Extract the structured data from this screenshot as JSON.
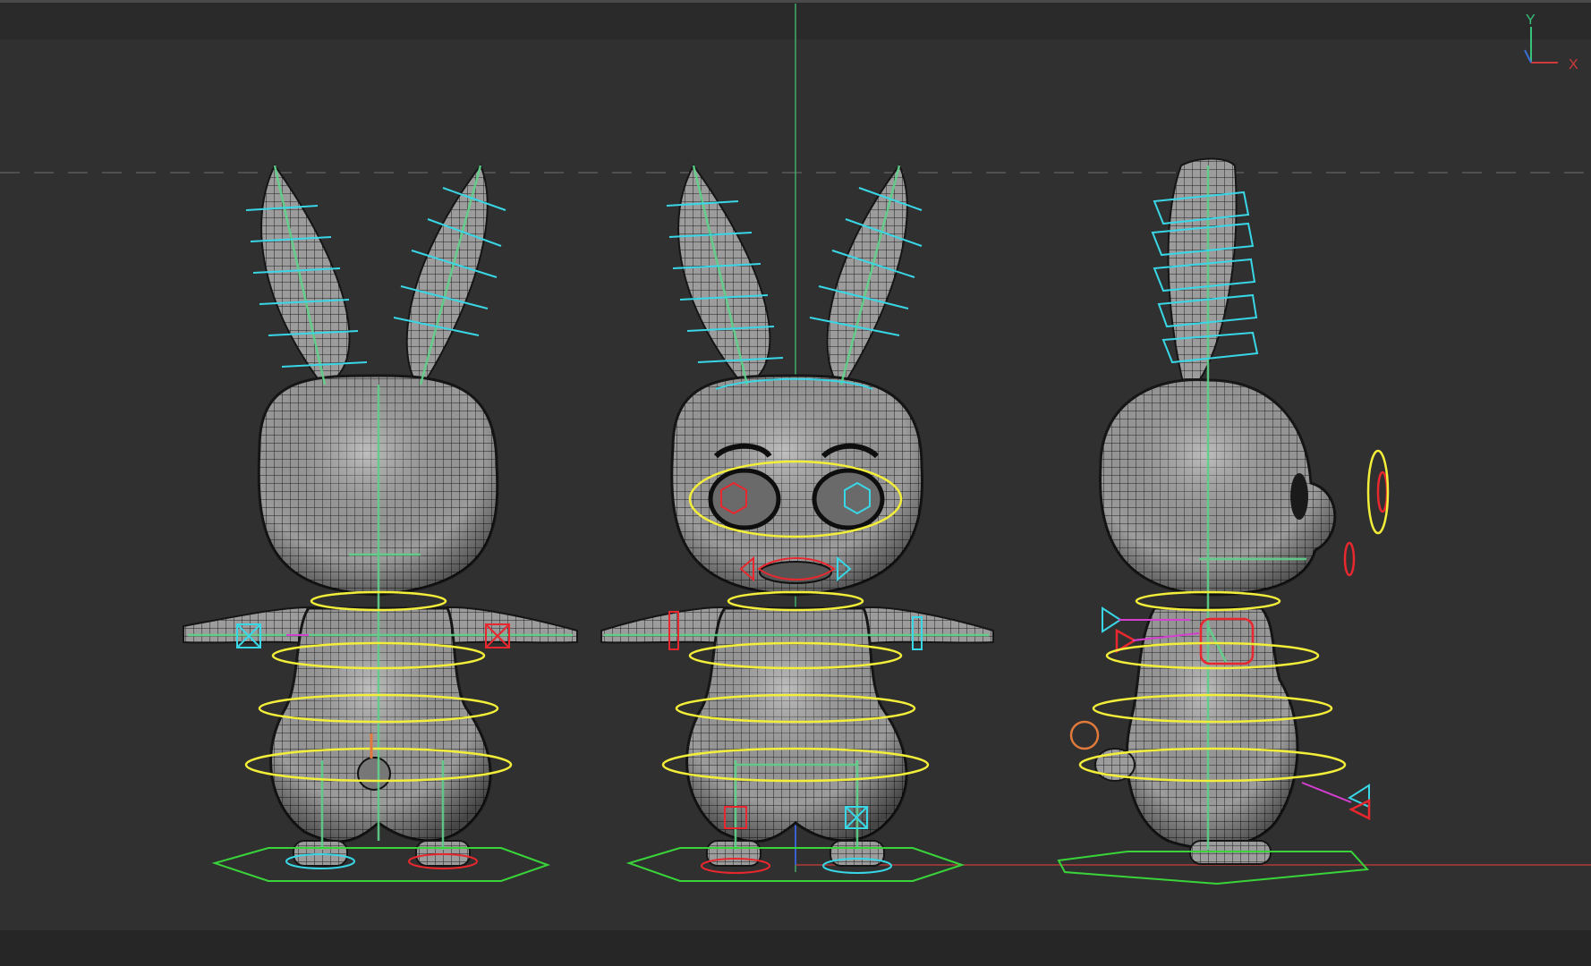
{
  "viewport": {
    "axis_indicator": {
      "y_label": "Y",
      "x_label": "X",
      "z_label": "z"
    },
    "colors": {
      "background": "#303030",
      "mesh_fill": "#9a9a9a",
      "mesh_line": "#1c1c1c",
      "bone": "#5fd38a",
      "ctrl_cyan": "#39d6e6",
      "ctrl_yellow": "#f2ee3a",
      "ctrl_red": "#e8282e",
      "ctrl_magenta": "#d43fd0",
      "ctrl_green": "#39d43a",
      "ctrl_orange": "#e07a3c"
    },
    "views": [
      "back-view",
      "front-view",
      "side-view"
    ]
  }
}
